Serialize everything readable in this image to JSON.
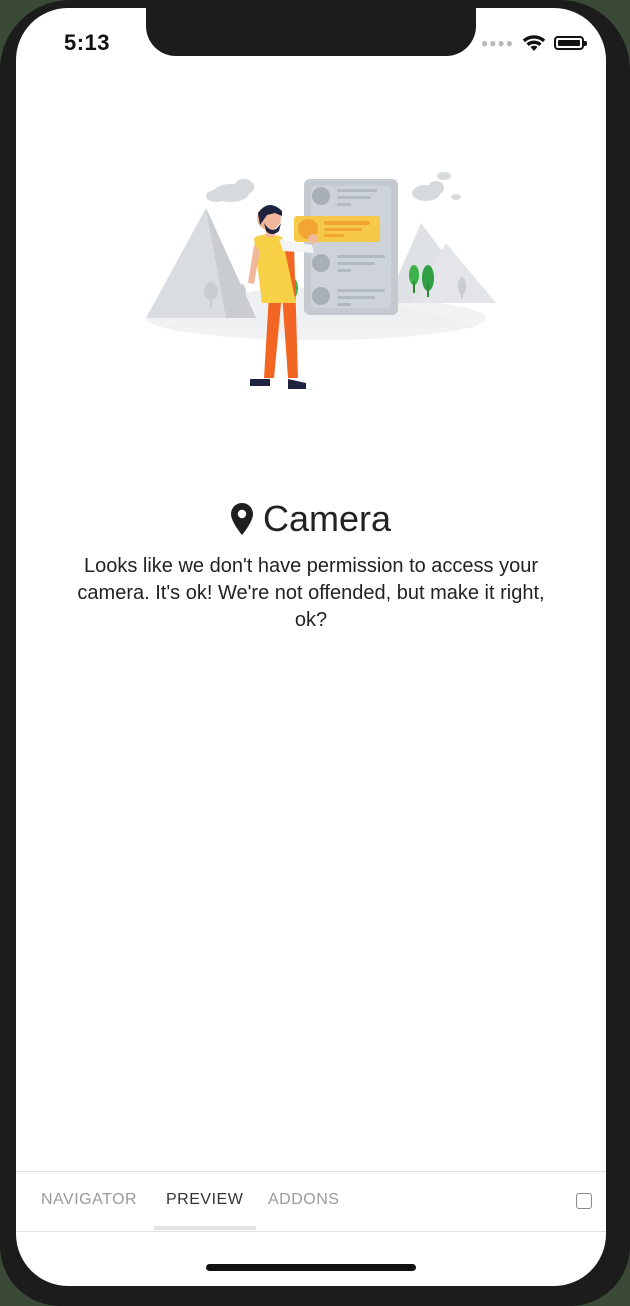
{
  "status_bar": {
    "time": "5:13"
  },
  "camera_screen": {
    "title": "Camera",
    "message": "Looks like we don't have permission to access your camera. It's ok! We're not offended, but make it right, ok?"
  },
  "tabs": [
    "NAVIGATOR",
    "PREVIEW",
    "ADDONS"
  ],
  "active_tab": "PREVIEW",
  "icons": {
    "title_icon": "map-pin-icon",
    "wifi": "wifi-icon",
    "battery": "battery-icon",
    "signal": "signal-dots-icon",
    "panel_toggle": "checkbox-icon"
  }
}
